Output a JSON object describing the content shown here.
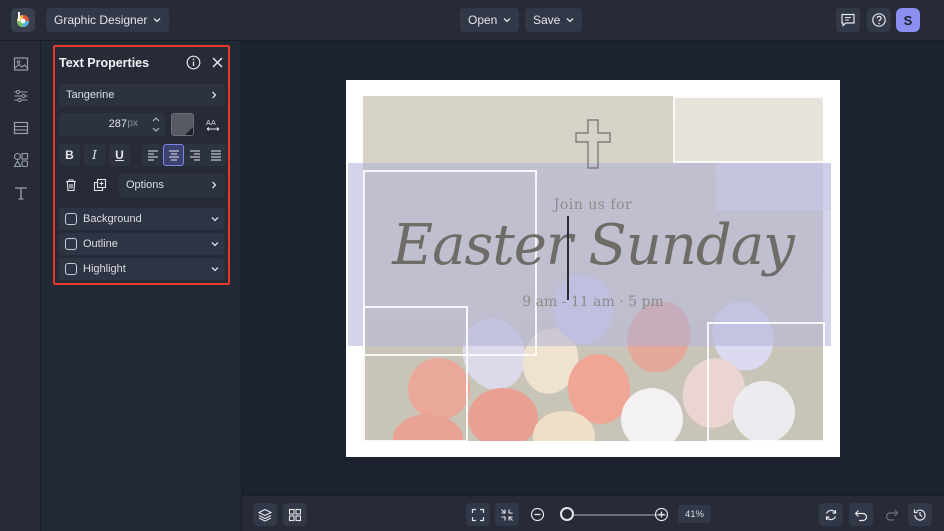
{
  "topbar": {
    "app_menu_label": "Graphic Designer",
    "open_label": "Open",
    "save_label": "Save",
    "avatar_initial": "S"
  },
  "rail": {
    "items": [
      "image-icon",
      "sliders-icon",
      "layout-icon",
      "shapes-icon",
      "text-icon"
    ]
  },
  "text_properties": {
    "title": "Text Properties",
    "font_name": "Tangerine",
    "font_size": "287",
    "font_size_unit": "px",
    "text_color": "#555a63",
    "bold_label": "B",
    "italic_label": "I",
    "underline_label": "U",
    "active_alignment": "center",
    "options_label": "Options",
    "toggles": [
      {
        "label": "Background",
        "checked": false
      },
      {
        "label": "Outline",
        "checked": false
      },
      {
        "label": "Highlight",
        "checked": false
      }
    ]
  },
  "canvas": {
    "line1": "Join us for",
    "title": "Easter Sunday",
    "line3": "9 am - 11 am · 5 pm",
    "overlay_color": "#afb0d7",
    "panel_highlight_color": "#e33a2a"
  },
  "bottombar": {
    "zoom_level": "41%",
    "zoom_fraction": 0.05
  }
}
